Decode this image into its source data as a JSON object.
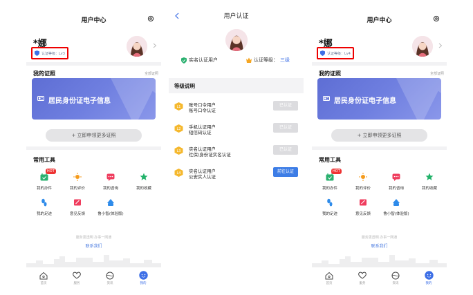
{
  "user_center": {
    "title": "用户中心",
    "name": "*娜",
    "section_cert_title": "我的证照",
    "section_cert_link": "全部证照",
    "id_card_label": "居民身份证电子信息",
    "apply_more": "+ 立即申领更多证照",
    "tools_title": "常用工具",
    "hot_badge": "HOT",
    "tools": [
      {
        "label": "我的办件",
        "icon": "calendar-icon",
        "color": "#2ab06f"
      },
      {
        "label": "我的评价",
        "icon": "sun-icon",
        "color": "#f59b1c"
      },
      {
        "label": "我的咨询",
        "icon": "chat-icon",
        "color": "#ef3d5e"
      },
      {
        "label": "我的收藏",
        "icon": "star-icon",
        "color": "#22b26a"
      },
      {
        "label": "我的足迹",
        "icon": "footprint-icon",
        "color": "#2e8bea"
      },
      {
        "label": "意见反馈",
        "icon": "feedback-icon",
        "color": "#ef3d5e"
      },
      {
        "label": "鲁小智(体验版)",
        "icon": "bot-icon",
        "color": "#2e8bea"
      }
    ],
    "footer_note": "服务更透明 办事一网通",
    "contact": "联系我们",
    "tabs": [
      {
        "label": "首页",
        "icon": "home-icon"
      },
      {
        "label": "服务",
        "icon": "heart-icon"
      },
      {
        "label": "资讯",
        "icon": "globe-icon"
      },
      {
        "label": "我的",
        "icon": "smile-icon"
      }
    ]
  },
  "screen_left": {
    "level_text": "认证等级：Lv3"
  },
  "screen_right": {
    "level_text": "认证等级：Lv4"
  },
  "verification": {
    "title": "用户认证",
    "verified_label": "实名认证用户",
    "level_label": "认证等级：",
    "level_value": "三级",
    "section_title": "等级说明",
    "levels": [
      {
        "badge": "L1",
        "line1": "账号口令用户",
        "line2": "账号口令认证",
        "button": "已认证",
        "state": "done"
      },
      {
        "badge": "L2",
        "line1": "手机认证用户",
        "line2": "短信码认证",
        "button": "已认证",
        "state": "done"
      },
      {
        "badge": "L3",
        "line1": "实名认证用户",
        "line2": "社保/身份证实名认证",
        "button": "已认证",
        "state": "done"
      },
      {
        "badge": "L4",
        "line1": "实名认证用户",
        "line2": "公安实人认证",
        "button": "前往认证",
        "state": "go"
      }
    ]
  },
  "colors": {
    "accent": "#3d6fe6",
    "alert": "#e00000",
    "card": "#6374da"
  }
}
